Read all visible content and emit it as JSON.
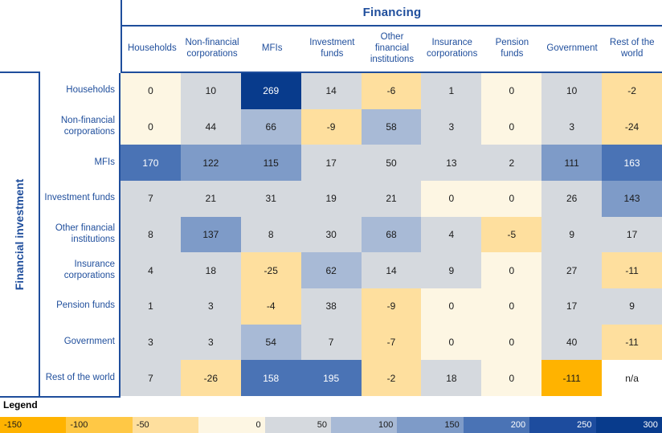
{
  "header": {
    "financing_title": "Financing",
    "investment_title": "Financial investment"
  },
  "columns": [
    "Households",
    "Non-financial corporations",
    "MFIs",
    "Investment funds",
    "Other financial institutions",
    "Insurance corporations",
    "Pension funds",
    "Government",
    "Rest of the world"
  ],
  "rows": [
    "Households",
    "Non-financial corporations",
    "MFIs",
    "Investment funds",
    "Other financial institutions",
    "Insurance corporations",
    "Pension funds",
    "Government",
    "Rest of the world"
  ],
  "legend": {
    "title": "Legend",
    "ticks": [
      "-150",
      "-100",
      "-50",
      "0",
      "50",
      "100",
      "150",
      "200",
      "250",
      "300"
    ],
    "colors": [
      "#FFB300",
      "#FFC845",
      "#FEDF9E",
      "#FDF6E3",
      "#D5D9DE",
      "#A8BAD6",
      "#7E9BC8",
      "#4A73B5",
      "#1D4C9E",
      "#083B8C"
    ]
  },
  "palette": {
    "orange_strong": "#FFB300",
    "orange_mid": "#FFC845",
    "orange_light": "#FEDF9E",
    "cream": "#FDF6E3",
    "grey": "#D5D9DE",
    "blue_1": "#A8BAD6",
    "blue_2": "#7E9BC8",
    "blue_3": "#4A73B5",
    "blue_4": "#1D4C9E",
    "blue_5": "#083B8C",
    "white": "#FFFFFF",
    "navy_text": "#1f4e9c"
  },
  "chart_data": {
    "type": "heatmap",
    "title": "Financial investment vs Financing",
    "xlabel": "Financing",
    "ylabel": "Financial investment",
    "categories": [
      "Households",
      "Non-financial corporations",
      "MFIs",
      "Investment funds",
      "Other financial institutions",
      "Insurance corporations",
      "Pension funds",
      "Government",
      "Rest of the world"
    ],
    "colorbar": {
      "ticks": [
        -150,
        -100,
        -50,
        0,
        50,
        100,
        150,
        200,
        250,
        300
      ],
      "range": [
        -150,
        300
      ]
    },
    "matrix": [
      {
        "row": "Households",
        "cells": [
          {
            "value": "0",
            "bg": "#FDF6E3",
            "light": false
          },
          {
            "value": "10",
            "bg": "#D5D9DE",
            "light": false
          },
          {
            "value": "269",
            "bg": "#083B8C",
            "light": true
          },
          {
            "value": "14",
            "bg": "#D5D9DE",
            "light": false
          },
          {
            "value": "-6",
            "bg": "#FEDF9E",
            "light": false
          },
          {
            "value": "1",
            "bg": "#D5D9DE",
            "light": false
          },
          {
            "value": "0",
            "bg": "#FDF6E3",
            "light": false
          },
          {
            "value": "10",
            "bg": "#D5D9DE",
            "light": false
          },
          {
            "value": "-2",
            "bg": "#FEDF9E",
            "light": false
          }
        ]
      },
      {
        "row": "Non-financial corporations",
        "cells": [
          {
            "value": "0",
            "bg": "#FDF6E3",
            "light": false
          },
          {
            "value": "44",
            "bg": "#D5D9DE",
            "light": false
          },
          {
            "value": "66",
            "bg": "#A8BAD6",
            "light": false
          },
          {
            "value": "-9",
            "bg": "#FEDF9E",
            "light": false
          },
          {
            "value": "58",
            "bg": "#A8BAD6",
            "light": false
          },
          {
            "value": "3",
            "bg": "#D5D9DE",
            "light": false
          },
          {
            "value": "0",
            "bg": "#FDF6E3",
            "light": false
          },
          {
            "value": "3",
            "bg": "#D5D9DE",
            "light": false
          },
          {
            "value": "-24",
            "bg": "#FEDF9E",
            "light": false
          }
        ]
      },
      {
        "row": "MFIs",
        "cells": [
          {
            "value": "170",
            "bg": "#4A73B5",
            "light": true
          },
          {
            "value": "122",
            "bg": "#7E9BC8",
            "light": false
          },
          {
            "value": "115",
            "bg": "#7E9BC8",
            "light": false
          },
          {
            "value": "17",
            "bg": "#D5D9DE",
            "light": false
          },
          {
            "value": "50",
            "bg": "#D5D9DE",
            "light": false
          },
          {
            "value": "13",
            "bg": "#D5D9DE",
            "light": false
          },
          {
            "value": "2",
            "bg": "#D5D9DE",
            "light": false
          },
          {
            "value": "111",
            "bg": "#7E9BC8",
            "light": false
          },
          {
            "value": "163",
            "bg": "#4A73B5",
            "light": true
          }
        ]
      },
      {
        "row": "Investment funds",
        "cells": [
          {
            "value": "7",
            "bg": "#D5D9DE",
            "light": false
          },
          {
            "value": "21",
            "bg": "#D5D9DE",
            "light": false
          },
          {
            "value": "31",
            "bg": "#D5D9DE",
            "light": false
          },
          {
            "value": "19",
            "bg": "#D5D9DE",
            "light": false
          },
          {
            "value": "21",
            "bg": "#D5D9DE",
            "light": false
          },
          {
            "value": "0",
            "bg": "#FDF6E3",
            "light": false
          },
          {
            "value": "0",
            "bg": "#FDF6E3",
            "light": false
          },
          {
            "value": "26",
            "bg": "#D5D9DE",
            "light": false
          },
          {
            "value": "143",
            "bg": "#7E9BC8",
            "light": false
          }
        ]
      },
      {
        "row": "Other financial institutions",
        "cells": [
          {
            "value": "8",
            "bg": "#D5D9DE",
            "light": false
          },
          {
            "value": "137",
            "bg": "#7E9BC8",
            "light": false
          },
          {
            "value": "8",
            "bg": "#D5D9DE",
            "light": false
          },
          {
            "value": "30",
            "bg": "#D5D9DE",
            "light": false
          },
          {
            "value": "68",
            "bg": "#A8BAD6",
            "light": false
          },
          {
            "value": "4",
            "bg": "#D5D9DE",
            "light": false
          },
          {
            "value": "-5",
            "bg": "#FEDF9E",
            "light": false
          },
          {
            "value": "9",
            "bg": "#D5D9DE",
            "light": false
          },
          {
            "value": "17",
            "bg": "#D5D9DE",
            "light": false
          }
        ]
      },
      {
        "row": "Insurance corporations",
        "cells": [
          {
            "value": "4",
            "bg": "#D5D9DE",
            "light": false
          },
          {
            "value": "18",
            "bg": "#D5D9DE",
            "light": false
          },
          {
            "value": "-25",
            "bg": "#FEDF9E",
            "light": false
          },
          {
            "value": "62",
            "bg": "#A8BAD6",
            "light": false
          },
          {
            "value": "14",
            "bg": "#D5D9DE",
            "light": false
          },
          {
            "value": "9",
            "bg": "#D5D9DE",
            "light": false
          },
          {
            "value": "0",
            "bg": "#FDF6E3",
            "light": false
          },
          {
            "value": "27",
            "bg": "#D5D9DE",
            "light": false
          },
          {
            "value": "-11",
            "bg": "#FEDF9E",
            "light": false
          }
        ]
      },
      {
        "row": "Pension funds",
        "cells": [
          {
            "value": "1",
            "bg": "#D5D9DE",
            "light": false
          },
          {
            "value": "3",
            "bg": "#D5D9DE",
            "light": false
          },
          {
            "value": "-4",
            "bg": "#FEDF9E",
            "light": false
          },
          {
            "value": "38",
            "bg": "#D5D9DE",
            "light": false
          },
          {
            "value": "-9",
            "bg": "#FEDF9E",
            "light": false
          },
          {
            "value": "0",
            "bg": "#FDF6E3",
            "light": false
          },
          {
            "value": "0",
            "bg": "#FDF6E3",
            "light": false
          },
          {
            "value": "17",
            "bg": "#D5D9DE",
            "light": false
          },
          {
            "value": "9",
            "bg": "#D5D9DE",
            "light": false
          }
        ]
      },
      {
        "row": "Government",
        "cells": [
          {
            "value": "3",
            "bg": "#D5D9DE",
            "light": false
          },
          {
            "value": "3",
            "bg": "#D5D9DE",
            "light": false
          },
          {
            "value": "54",
            "bg": "#A8BAD6",
            "light": false
          },
          {
            "value": "7",
            "bg": "#D5D9DE",
            "light": false
          },
          {
            "value": "-7",
            "bg": "#FEDF9E",
            "light": false
          },
          {
            "value": "0",
            "bg": "#FDF6E3",
            "light": false
          },
          {
            "value": "0",
            "bg": "#FDF6E3",
            "light": false
          },
          {
            "value": "40",
            "bg": "#D5D9DE",
            "light": false
          },
          {
            "value": "-11",
            "bg": "#FEDF9E",
            "light": false
          }
        ]
      },
      {
        "row": "Rest of the world",
        "cells": [
          {
            "value": "7",
            "bg": "#D5D9DE",
            "light": false
          },
          {
            "value": "-26",
            "bg": "#FEDF9E",
            "light": false
          },
          {
            "value": "158",
            "bg": "#4A73B5",
            "light": true
          },
          {
            "value": "195",
            "bg": "#4A73B5",
            "light": true
          },
          {
            "value": "-2",
            "bg": "#FEDF9E",
            "light": false
          },
          {
            "value": "18",
            "bg": "#D5D9DE",
            "light": false
          },
          {
            "value": "0",
            "bg": "#FDF6E3",
            "light": false
          },
          {
            "value": "-111",
            "bg": "#FFB300",
            "light": false
          },
          {
            "value": "n/a",
            "bg": "#FFFFFF",
            "light": false
          }
        ]
      }
    ]
  }
}
